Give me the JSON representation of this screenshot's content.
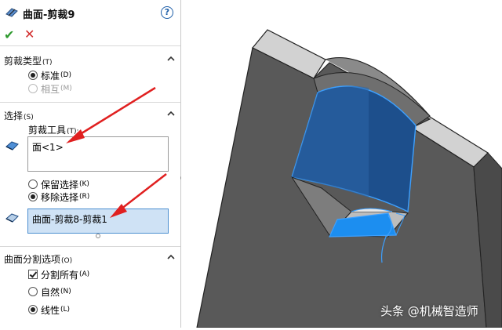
{
  "feature": {
    "title": "曲面-剪裁9",
    "help": "?"
  },
  "actions": {
    "ok": "✔",
    "cancel": "✕"
  },
  "trim_type": {
    "title": "剪裁类型",
    "title_key": "(T)",
    "options": [
      {
        "label": "标准",
        "key": "(D)",
        "selected": true,
        "enabled": true
      },
      {
        "label": "相互",
        "key": "(M)",
        "selected": false,
        "enabled": false
      }
    ]
  },
  "selections": {
    "title": "选择",
    "title_key": "(S)",
    "tool_label": "剪裁工具",
    "tool_key": "(T):",
    "tool_value": "面<1>",
    "keep_options": [
      {
        "label": "保留选择",
        "key": "(K)",
        "selected": false
      },
      {
        "label": "移除选择",
        "key": "(R)",
        "selected": true
      }
    ],
    "pieces_value": "曲面-剪裁8-剪裁1"
  },
  "split_options": {
    "title": "曲面分割选项",
    "title_key": "(O)",
    "split_all": {
      "label": "分割所有",
      "key": "(A)",
      "checked": true
    },
    "options": [
      {
        "label": "自然",
        "key": "(N)",
        "selected": false
      },
      {
        "label": "线性",
        "key": "(L)",
        "selected": true
      }
    ]
  },
  "watermark": "头条 @机械智造师",
  "colors": {
    "arrow": "#e02020",
    "accent": "#1d5ea8",
    "surface_blue": "#1a4f8f",
    "face_gray": "#5a5a5a"
  }
}
